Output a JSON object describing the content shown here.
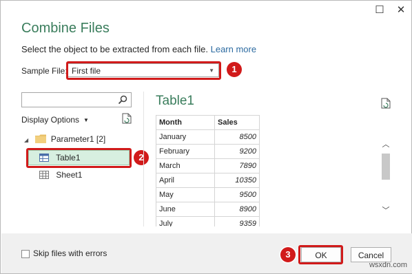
{
  "dialog": {
    "title": "Combine Files",
    "subtitle": "Select the object to be extracted from each file.",
    "learn_more": "Learn more",
    "maximize_glyph": "☐",
    "close_glyph": "✕"
  },
  "sample_file": {
    "label": "Sample File:",
    "value": "First file"
  },
  "navigator": {
    "search_value": "",
    "display_options": "Display Options",
    "tree": {
      "folder": "Parameter1 [2]",
      "items": [
        {
          "label": "Table1",
          "selected": true
        },
        {
          "label": "Sheet1",
          "selected": false
        }
      ]
    }
  },
  "preview": {
    "title": "Table1",
    "columns": [
      "Month",
      "Sales"
    ],
    "rows": [
      [
        "January",
        "8500"
      ],
      [
        "February",
        "9200"
      ],
      [
        "March",
        "7890"
      ],
      [
        "April",
        "10350"
      ],
      [
        "May",
        "9500"
      ],
      [
        "June",
        "8900"
      ],
      [
        "July",
        "9359"
      ]
    ]
  },
  "footer": {
    "skip_label": "Skip files with errors",
    "skip_checked": false,
    "ok_label": "OK",
    "cancel_label": "Cancel"
  },
  "annotations": {
    "badge1": "1",
    "badge2": "2",
    "badge3": "3",
    "highlight_color": "#d11a1a"
  },
  "watermark": "wsxdn.com",
  "colors": {
    "accent_green": "#3a7d5c",
    "link_blue": "#2b6aa0",
    "selected_bg": "#d7efe0"
  }
}
